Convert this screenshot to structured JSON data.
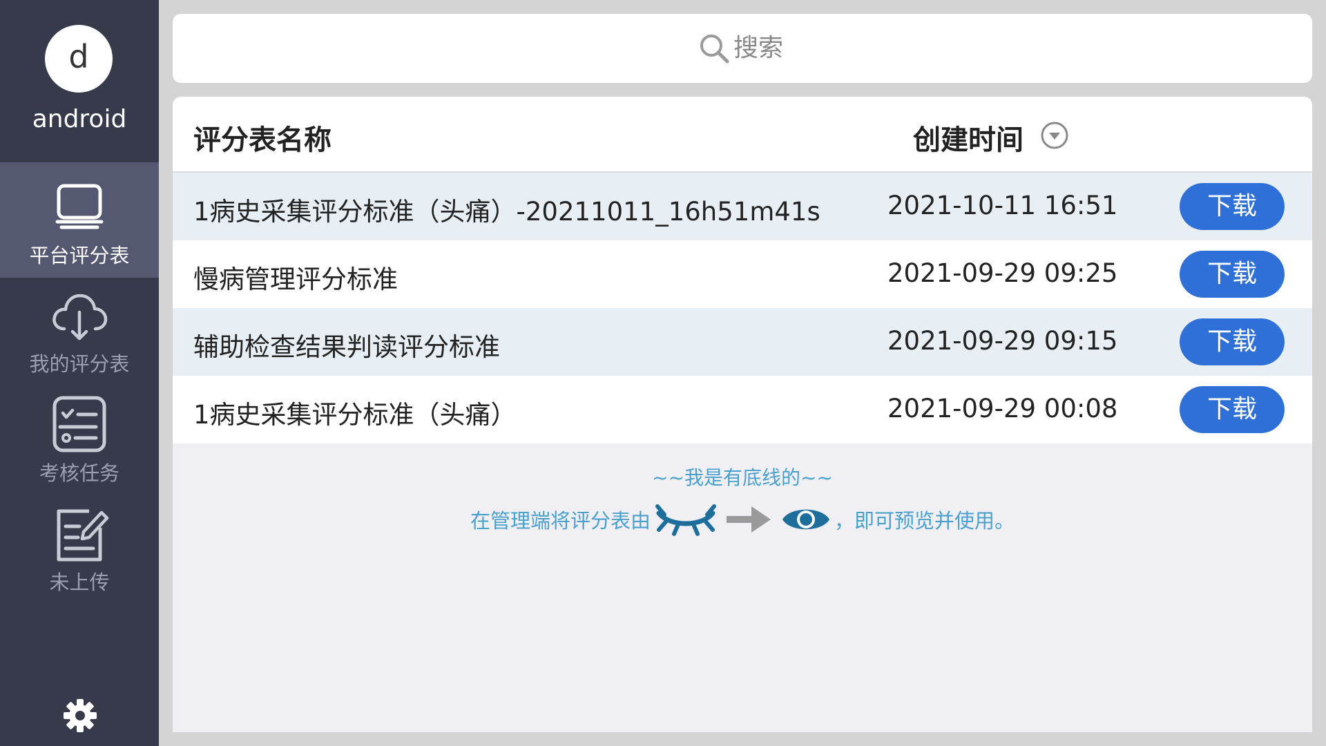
{
  "profile": {
    "avatar_letter": "d",
    "username": "android"
  },
  "sidebar": {
    "items": [
      {
        "label": "平台评分表",
        "icon": "monitor-icon",
        "active": true
      },
      {
        "label": "我的评分表",
        "icon": "cloud-download-icon",
        "active": false
      },
      {
        "label": "考核任务",
        "icon": "task-list-icon",
        "active": false
      },
      {
        "label": "未上传",
        "icon": "edit-document-icon",
        "active": false
      }
    ],
    "settings_icon": "gear-icon"
  },
  "search": {
    "placeholder": "搜索",
    "icon": "search-icon"
  },
  "table": {
    "headers": {
      "name": "评分表名称",
      "time": "创建时间",
      "sort_icon": "sort-dropdown-icon"
    },
    "rows": [
      {
        "name": "1病史采集评分标准（头痛）-20211011_16h51m41s",
        "time": "2021-10-11 16:51",
        "action": "下载"
      },
      {
        "name": "慢病管理评分标准",
        "time": "2021-09-29 09:25",
        "action": "下载"
      },
      {
        "name": "辅助检查结果判读评分标准",
        "time": "2021-09-29 09:15",
        "action": "下载"
      },
      {
        "name": "1病史采集评分标准（头痛）",
        "time": "2021-09-29 00:08",
        "action": "下载"
      }
    ]
  },
  "footer": {
    "end_text": "~~我是有底线的~~",
    "hint_prefix": "在管理端将评分表由",
    "hint_suffix": "，即可预览并使用。",
    "icons": [
      "eye-closed-icon",
      "arrow-right-icon",
      "eye-open-icon"
    ]
  },
  "colors": {
    "sidebar_bg": "#373a4a",
    "sidebar_active": "#545870",
    "accent_button": "#2e6fd8",
    "hint_text": "#4aa0cc",
    "eye_icon": "#1e6e9c"
  }
}
